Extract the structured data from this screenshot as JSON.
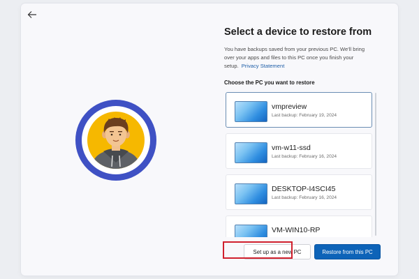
{
  "page": {
    "back_icon": "back-arrow-icon",
    "avatar_icon": "user-avatar-icon",
    "title": "Select a device to restore from",
    "description": "You have backups saved from your previous PC. We'll bring over your apps and files to this PC once you finish your setup.",
    "privacy_link": "Privacy Statement",
    "subheading": "Choose the PC you want to restore"
  },
  "devices": [
    {
      "name": "vmpreview",
      "last_backup": "Last backup: February 19, 2024",
      "selected": true
    },
    {
      "name": "vm-w11-ssd",
      "last_backup": "Last backup: February 16, 2024",
      "selected": false
    },
    {
      "name": "DESKTOP-I4SCI45",
      "last_backup": "Last backup: February 16, 2024",
      "selected": false
    },
    {
      "name": "VM-WIN10-RP",
      "last_backup": "",
      "selected": false
    }
  ],
  "buttons": {
    "new_pc": "Set up as a new PC",
    "restore": "Restore from this PC"
  },
  "colors": {
    "primary_button": "#0d63b8",
    "highlight_box": "#d0202d",
    "avatar_ring": "#3f51c4",
    "avatar_background": "#f6b800"
  }
}
